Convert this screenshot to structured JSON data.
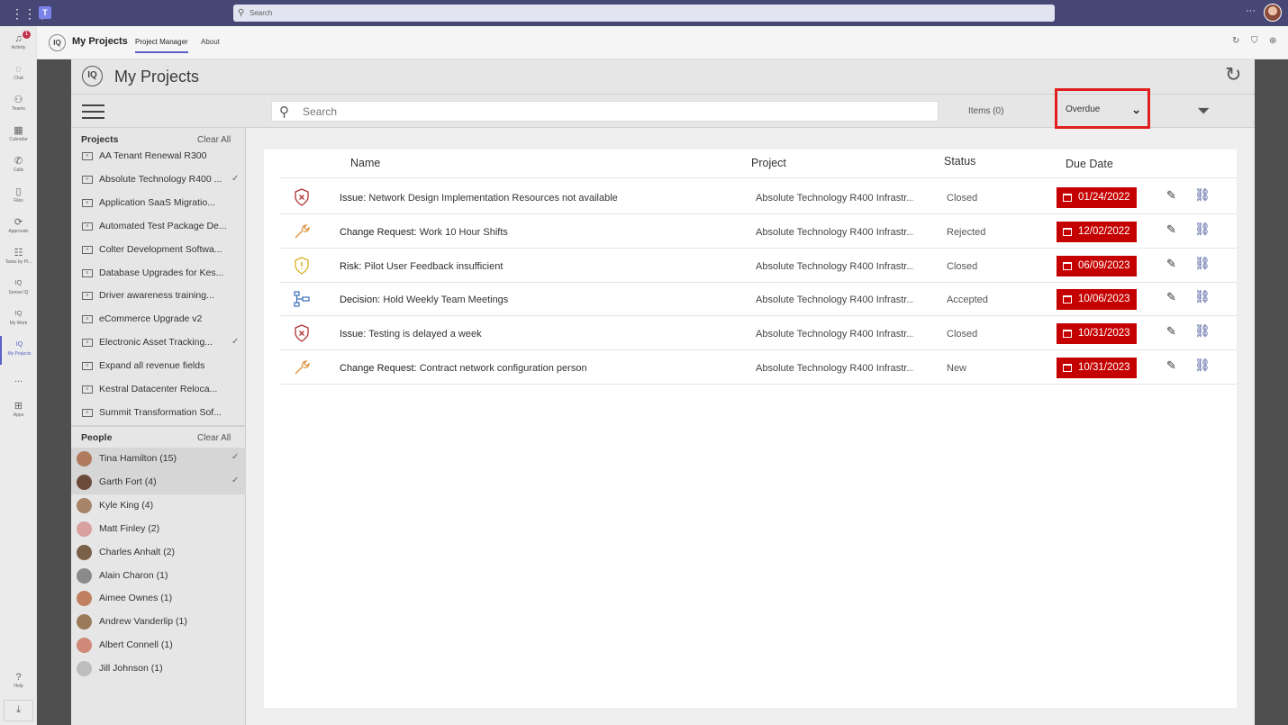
{
  "teams": {
    "search_placeholder": "Search",
    "rail": [
      {
        "label": "Activity",
        "icon": "bell-icon",
        "badge": "1"
      },
      {
        "label": "Chat",
        "icon": "chat-icon"
      },
      {
        "label": "Teams",
        "icon": "teams-icon"
      },
      {
        "label": "Calendar",
        "icon": "calendar-icon"
      },
      {
        "label": "Calls",
        "icon": "phone-icon"
      },
      {
        "label": "Files",
        "icon": "file-icon"
      },
      {
        "label": "Approvals",
        "icon": "approvals-icon"
      },
      {
        "label": "Tasks by Pl...",
        "icon": "tasks-icon"
      },
      {
        "label": "Sensei IQ",
        "icon": "iq-icon"
      },
      {
        "label": "My Work",
        "icon": "iq-icon"
      },
      {
        "label": "My Projects",
        "icon": "iq-icon"
      },
      {
        "label": "...",
        "icon": "more-icon"
      },
      {
        "label": "Apps",
        "icon": "apps-icon"
      },
      {
        "label": "Help",
        "icon": "help-icon"
      }
    ],
    "app_title": "My Projects",
    "tabs": [
      "Project Manager",
      "About"
    ]
  },
  "app": {
    "logo_text": "IQ",
    "title": "My Projects",
    "search_placeholder": "Search",
    "items_label": "Items (0)",
    "filter_value": "Overdue",
    "projects_header": "Projects",
    "people_header": "People",
    "clear_all": "Clear All",
    "projects": [
      {
        "label": "AA Tenant Renewal R300",
        "checked": false
      },
      {
        "label": "Absolute Technology R400 ...",
        "checked": true
      },
      {
        "label": "Application SaaS Migratio...",
        "checked": false
      },
      {
        "label": "Automated Test Package De...",
        "checked": false
      },
      {
        "label": "Colter Development Softwa...",
        "checked": false
      },
      {
        "label": "Database Upgrades for Kes...",
        "checked": false
      },
      {
        "label": "Driver awareness training...",
        "checked": false
      },
      {
        "label": "eCommerce Upgrade v2",
        "checked": false
      },
      {
        "label": "Electronic Asset Tracking...",
        "checked": true
      },
      {
        "label": "Expand all revenue fields",
        "checked": false
      },
      {
        "label": "Kestral Datacenter Reloca...",
        "checked": false
      },
      {
        "label": "Summit Transformation Sof...",
        "checked": false
      }
    ],
    "people": [
      {
        "label": "Tina Hamilton (15)",
        "selected": true,
        "color": "#b07a5e"
      },
      {
        "label": "Garth Fort (4)",
        "selected": true,
        "color": "#6b4a3a"
      },
      {
        "label": "Kyle King (4)",
        "selected": false,
        "color": "#a88468"
      },
      {
        "label": "Matt Finley (2)",
        "selected": false,
        "color": "#d9a0a0"
      },
      {
        "label": "Charles Anhalt (2)",
        "selected": false,
        "color": "#7a6048"
      },
      {
        "label": "Alain Charon (1)",
        "selected": false,
        "color": "#8a8a8a"
      },
      {
        "label": "Aimee Ownes (1)",
        "selected": false,
        "color": "#c08060"
      },
      {
        "label": "Andrew Vanderlip (1)",
        "selected": false,
        "color": "#9a7a5a"
      },
      {
        "label": "Albert Connell (1)",
        "selected": false,
        "color": "#d08878"
      },
      {
        "label": "Jill Johnson (1)",
        "selected": false,
        "color": "#bdbdbd"
      }
    ],
    "columns": {
      "name": "Name",
      "project": "Project",
      "status": "Status",
      "due": "Due Date"
    },
    "rows": [
      {
        "icon": "issue-shield-icon",
        "type": "Issue:",
        "title": "Network Design Implementation Resources not available",
        "project": "Absolute Technology R400 Infrastr...",
        "status": "Closed",
        "due": "01/24/2022"
      },
      {
        "icon": "change-request-wrench-icon",
        "type": "Change Request:",
        "title": "Work 10 Hour Shifts",
        "project": "Absolute Technology R400 Infrastr...",
        "status": "Rejected",
        "due": "12/02/2022"
      },
      {
        "icon": "risk-shield-icon",
        "type": "Risk:",
        "title": "Pilot User Feedback insufficient",
        "project": "Absolute Technology R400 Infrastr...",
        "status": "Closed",
        "due": "06/09/2023"
      },
      {
        "icon": "decision-icon",
        "type": "Decision:",
        "title": "Hold Weekly Team Meetings",
        "project": "Absolute Technology R400 Infrastr...",
        "status": "Accepted",
        "due": "10/06/2023"
      },
      {
        "icon": "issue-shield-icon",
        "type": "Issue:",
        "title": "Testing is delayed a week",
        "project": "Absolute Technology R400 Infrastr...",
        "status": "Closed",
        "due": "10/31/2023"
      },
      {
        "icon": "change-request-wrench-icon",
        "type": "Change Request:",
        "title": "Contract network configuration person",
        "project": "Absolute Technology R400 Infrastr...",
        "status": "New",
        "due": "10/31/2023"
      }
    ],
    "colors": {
      "overdue": "#c50000",
      "highlight": "#e02020",
      "teams_bar": "#464775"
    }
  }
}
